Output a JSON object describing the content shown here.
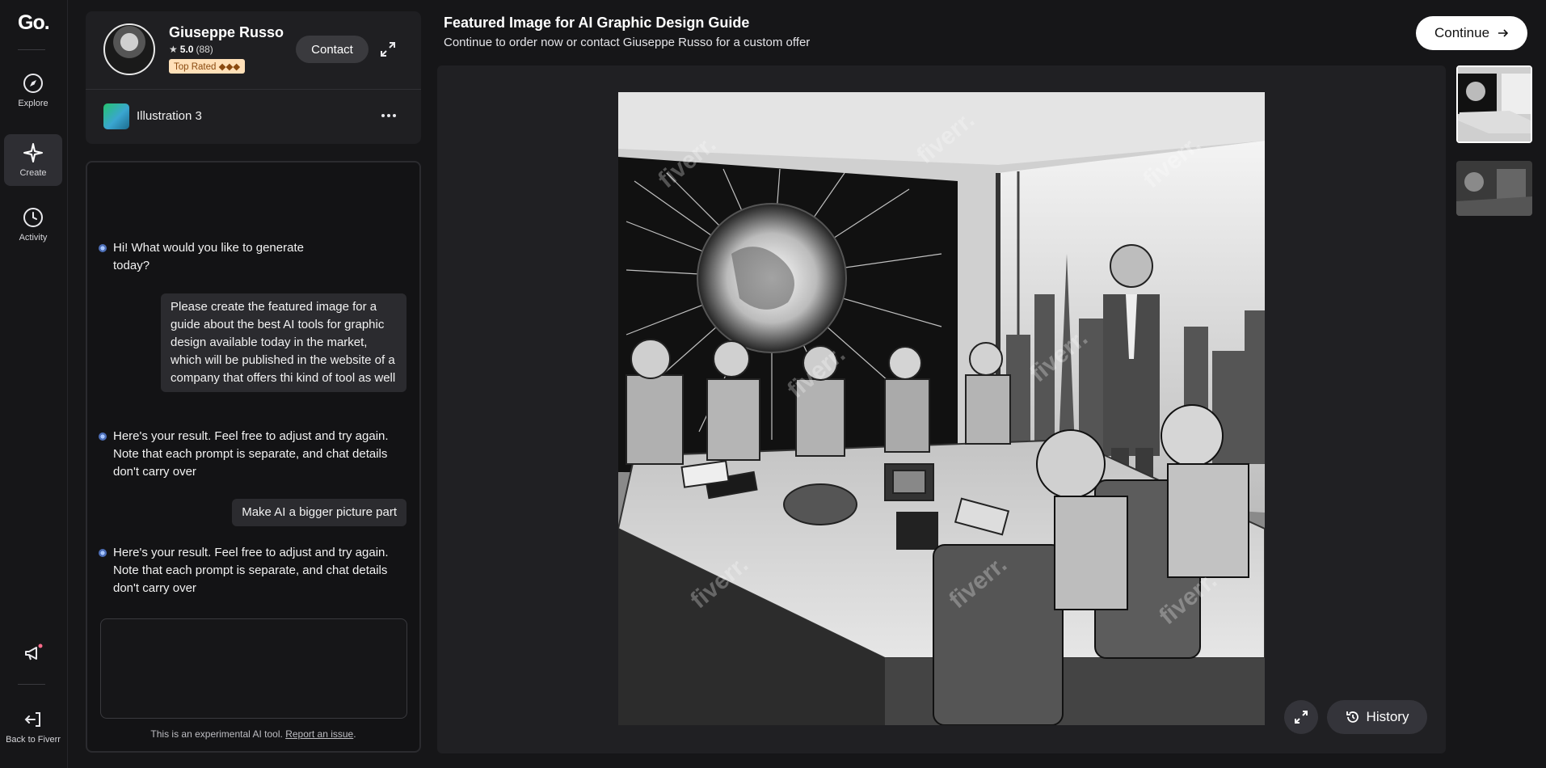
{
  "rail": {
    "logo": "Go.",
    "items": [
      {
        "label": "Explore",
        "icon": "compass-icon"
      },
      {
        "label": "Create",
        "icon": "sparkle-icon",
        "active": true
      },
      {
        "label": "Activity",
        "icon": "clock-icon"
      }
    ],
    "announcements_icon": "megaphone-icon",
    "back_label": "Back to Fiverr"
  },
  "seller": {
    "name": "Giuseppe Russo",
    "rating": "5.0",
    "reviews": "(88)",
    "badge": "Top Rated ◆◆◆",
    "contact_label": "Contact"
  },
  "gig": {
    "label": "Illustration 3"
  },
  "chat": {
    "messages": [
      {
        "role": "bot",
        "text": "Hi! What would you like to generate today?"
      },
      {
        "role": "user",
        "text": "Please create the featured image for a guide about the best AI tools for graphic design available today in the market, which will be published in the website of a company that offers thi kind of tool as well"
      },
      {
        "role": "bot",
        "text": "Here's your result. Feel free to adjust and try again. Note that each prompt is separate, and chat details don't carry over"
      },
      {
        "role": "user",
        "text": "Make AI a bigger picture part"
      },
      {
        "role": "bot",
        "text": "Here's your result. Feel free to adjust and try again. Note that each prompt is separate, and chat details don't carry over"
      }
    ],
    "input_value": "",
    "disclaimer": "This is an experimental AI tool.",
    "report_link": "Report an issue",
    "disclaimer_end": "."
  },
  "header": {
    "title": "Featured Image for AI Graphic Design Guide",
    "subtitle": "Continue to order now or contact Giuseppe Russo for a custom offer",
    "continue_label": "Continue"
  },
  "viewer": {
    "watermark": "fiverr.",
    "history_label": "History"
  },
  "colors": {
    "background": "#161618",
    "panel": "#1f1f22",
    "badge_bg": "#ffe0b8",
    "badge_text": "#8a4a10",
    "notification_dot": "#ff6b8a"
  }
}
